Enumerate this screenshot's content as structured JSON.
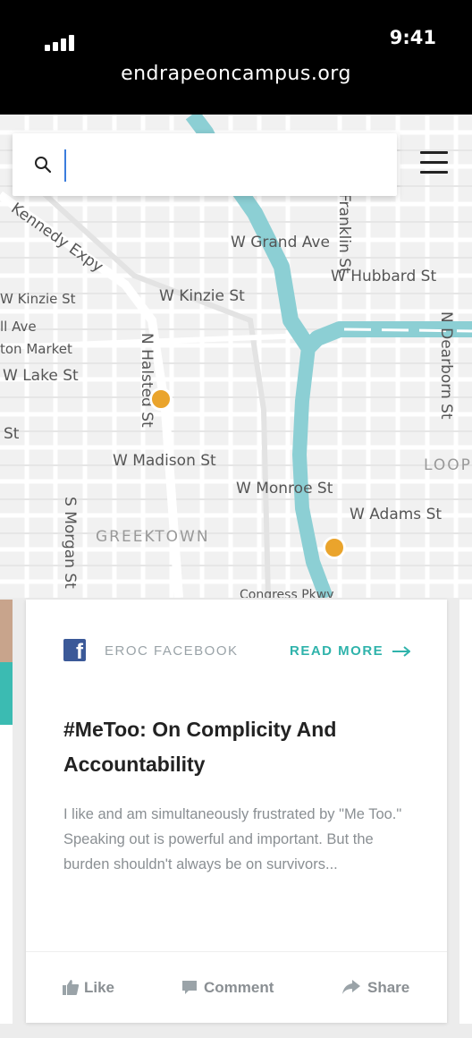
{
  "status_bar": {
    "time": "9:41",
    "url": "endrapeoncampus.org"
  },
  "search": {
    "placeholder": "",
    "value": ""
  },
  "map": {
    "labels": {
      "kennedy": "Kennedy Expy",
      "grand": "W Grand Ave",
      "franklin": "Franklin St",
      "hubbard": "W Hubbard St",
      "kinzie_left": "W Kinzie St",
      "kinzie": "W Kinzie St",
      "lake_ave": "ll Ave",
      "fulton": "ton Market",
      "lake": "W Lake St",
      "st": "St",
      "halsted": "N Halsted St",
      "dearborn": "N Dearborn St",
      "madison": "W Madison St",
      "monroe": "W Monroe St",
      "adams": "W Adams St",
      "morgan": "S Morgan St",
      "greektown": "GREEKTOWN",
      "loop": "LOOP",
      "congress": "Congress Pkwy"
    },
    "colors": {
      "river": "#8ccfd4",
      "pin": "#eaa42c"
    }
  },
  "card": {
    "source_icon": "facebook-icon",
    "source": "EROC FACEBOOK",
    "read_more": "READ MORE",
    "title": "#MeToo: On Complicity And Accountability",
    "excerpt": "I like and am simultaneously frustrated by \"Me Too.\" Speaking out is powerful and important. But the burden shouldn't always be on survivors...",
    "actions": {
      "like": "Like",
      "comment": "Comment",
      "share": "Share"
    },
    "accent_color": "#2fb3ab"
  }
}
